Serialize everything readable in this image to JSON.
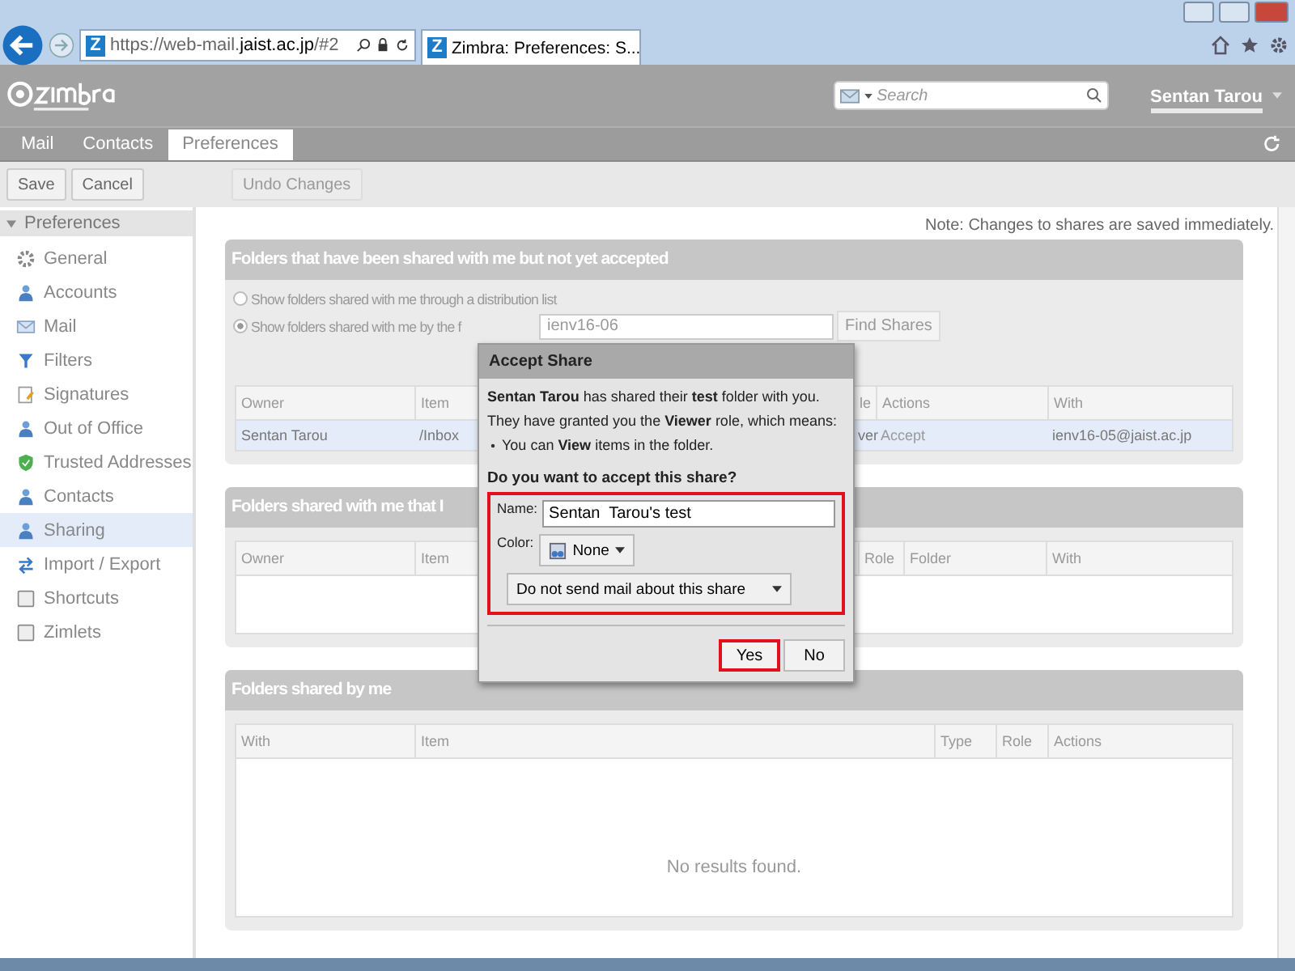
{
  "browser": {
    "favicon": "Z",
    "url_host": "https://web-mail.",
    "url_domain": "jaist.ac.jp",
    "url_path": "/#2",
    "tab_favicon": "Z",
    "tab_title": "Zimbra: Preferences: S..."
  },
  "app": {
    "search_placeholder": "Search",
    "user": "Sentan Tarou",
    "tabs": [
      {
        "label": "Mail",
        "selected": false
      },
      {
        "label": "Contacts",
        "selected": false
      },
      {
        "label": "Preferences",
        "selected": true
      }
    ],
    "toolbar": [
      {
        "label": "Save",
        "disabled": false
      },
      {
        "label": "Cancel",
        "disabled": false
      },
      {
        "label": "Undo Changes",
        "disabled": true
      }
    ]
  },
  "sidebar": {
    "title": "Preferences",
    "expanded": true,
    "items": [
      {
        "label": "General",
        "selected": false
      },
      {
        "label": "Accounts",
        "selected": false
      },
      {
        "label": "Mail",
        "selected": false
      },
      {
        "label": "Filters",
        "selected": false
      },
      {
        "label": "Signatures",
        "selected": false
      },
      {
        "label": "Out of Office",
        "selected": false
      },
      {
        "label": "Trusted Addresses",
        "selected": false
      },
      {
        "label": "Contacts",
        "selected": false
      },
      {
        "label": "Sharing",
        "selected": true
      },
      {
        "label": "Import / Export",
        "selected": false
      },
      {
        "label": "Shortcuts",
        "selected": false
      },
      {
        "label": "Zimlets",
        "selected": false
      }
    ]
  },
  "note": "Note: Changes to shares are saved immediately.",
  "sections": [
    {
      "title": "Folders that have been shared with me but not yet accepted",
      "radios": [
        {
          "label": "Show folders shared with me through a distribution list",
          "selected": false
        },
        {
          "label": "Show folders shared with me by the f",
          "selected": true
        }
      ],
      "filter_value": "ienv16-06",
      "find_button": "Find Shares",
      "table": {
        "columns": [
          "Owner",
          "Item",
          "le",
          "Actions",
          "With"
        ],
        "rows": [
          [
            "Sentan Tarou",
            "/Inbox",
            "ver",
            "Accept",
            "ienv16-05@jaist.ac.jp"
          ]
        ]
      }
    },
    {
      "title": "Folders shared with me that I",
      "table": {
        "columns": [
          "Owner",
          "Item",
          "Role",
          "Folder",
          "With"
        ]
      }
    },
    {
      "title": "Folders shared by me",
      "table": {
        "columns": [
          "With",
          "Item",
          "Type",
          "Role",
          "Actions"
        ],
        "empty": "No results found."
      }
    }
  ],
  "dialog": {
    "title": "Accept Share",
    "message": "**Sentan Tarou** has shared their **test** folder with you.",
    "role_line": "They have granted you the **Viewer** role, which means:",
    "bullet": "You can **View** items in the folder.",
    "question": "Do you want to accept this share?",
    "form_highlighted": true,
    "name_label": "Name:",
    "name_value": "Sentan  Tarou's test",
    "color_label": "Color:",
    "color_value": "None",
    "notify_value": "Do not send mail about this share",
    "buttons": [
      {
        "label": "Yes",
        "highlighted": true
      },
      {
        "label": "No",
        "highlighted": false
      }
    ]
  }
}
